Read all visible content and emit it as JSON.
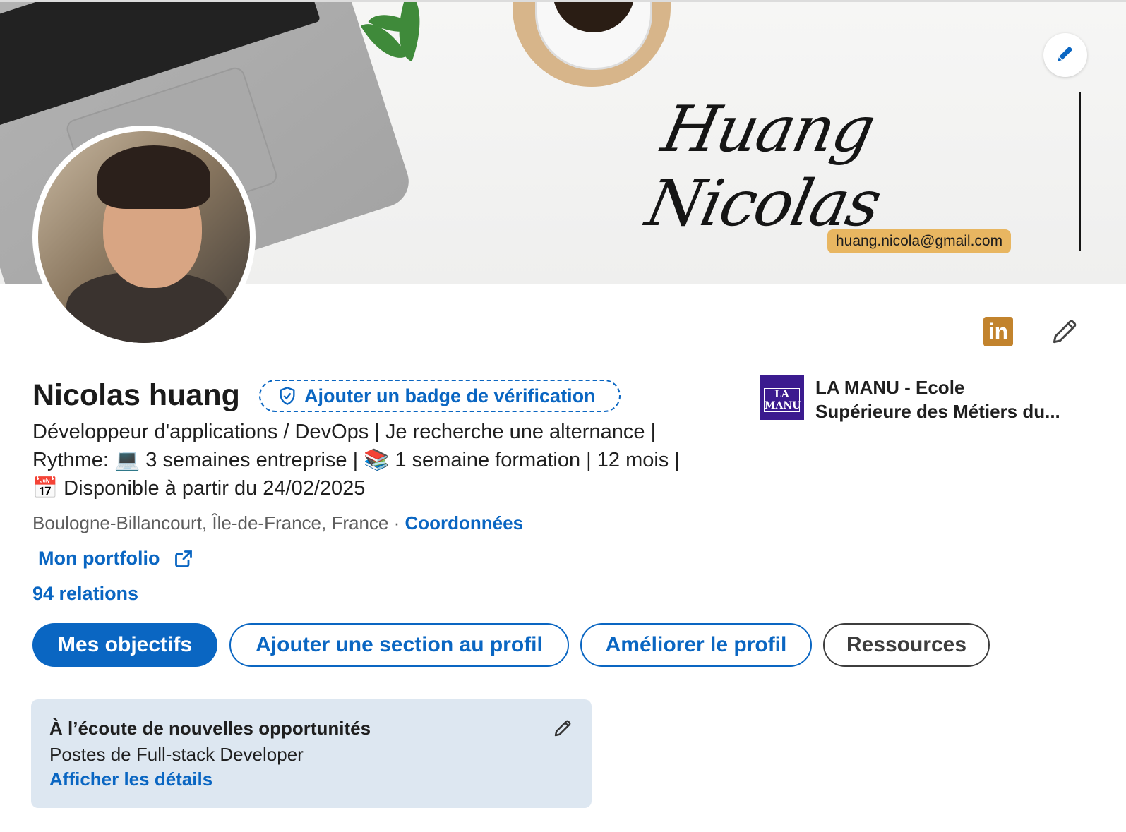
{
  "banner": {
    "signature": "Huang Nicolas",
    "email": "huang.nicola@gmail.com"
  },
  "profile": {
    "name": "Nicolas huang",
    "badge_label": "Ajouter un badge de vérification",
    "headline_line1": "Développeur d'applications / DevOps | Je recherche une alternance |",
    "headline_line2_prefix": "Rythme:",
    "headline_line2_a": "3 semaines entreprise |",
    "headline_line2_b": "1 semaine formation | 12 mois |",
    "headline_line3": "Disponible à partir du 24/02/2025",
    "location": "Boulogne-Billancourt, Île-de-France, France",
    "location_sep": "·",
    "contact_link": "Coordonnées",
    "portfolio_link": "Mon portfolio",
    "relations": "94 relations"
  },
  "school": {
    "logo_text": "LA MANU",
    "name_line1": "LA MANU - Ecole",
    "name_line2": "Supérieure des Métiers du..."
  },
  "actions": {
    "primary": "Mes objectifs",
    "add_section": "Ajouter une section au profil",
    "improve": "Améliorer le profil",
    "resources": "Ressources"
  },
  "open_to_work": {
    "title": "À l’écoute de nouvelles opportunités",
    "subtitle": "Postes de Full-stack Developer",
    "link": "Afficher les détails"
  },
  "icons": {
    "linkedin_logo": "in"
  },
  "colors": {
    "accent": "#0a66c2",
    "card_bg": "#dde7f1",
    "email_pill": "#e8b661",
    "linkedin_logo": "#c2832d"
  }
}
